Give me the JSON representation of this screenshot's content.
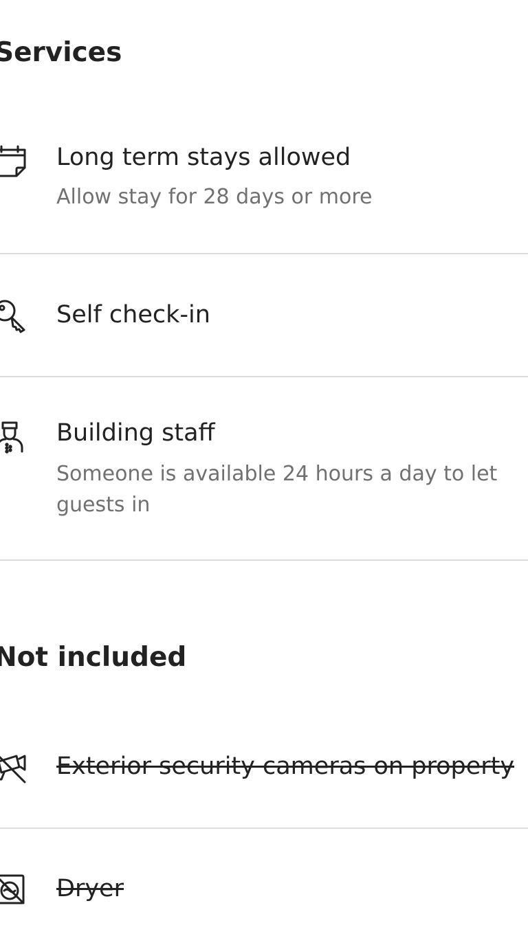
{
  "services": {
    "heading": "Services",
    "items": [
      {
        "title": "Long term stays allowed",
        "subtitle": "Allow stay for 28 days or more",
        "icon": "calendar-icon"
      },
      {
        "title": "Self check-in",
        "icon": "key-icon"
      },
      {
        "title": "Building staff",
        "subtitle": "Someone is available 24 hours a day to let guests in",
        "icon": "building-staff-icon"
      }
    ]
  },
  "not_included": {
    "heading": "Not included",
    "items": [
      {
        "title": "Exterior security cameras on property",
        "icon": "security-camera-off-icon",
        "struck_through": true
      },
      {
        "title": "Dryer",
        "icon": "dryer-off-icon",
        "struck_through": true
      }
    ]
  }
}
